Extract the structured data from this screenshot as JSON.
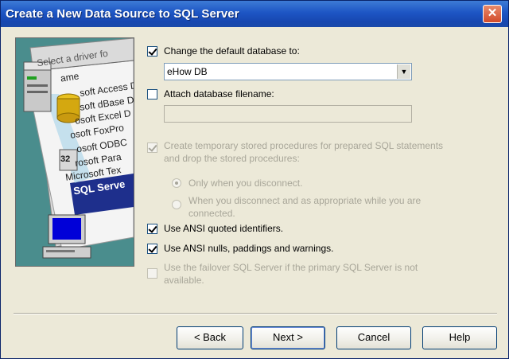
{
  "window": {
    "title": "Create a New Data Source to SQL Server",
    "close_glyph": "✕"
  },
  "wizard_image": {
    "header_text": "Select a driver fo",
    "list_items": [
      "ame",
      "soft Access D",
      "soft dBase D",
      "osoft Excel D",
      "osoft FoxPro",
      "osoft ODBC",
      "rosoft Para",
      "Microsoft Tex"
    ],
    "selected_item": "SQL Serve",
    "badge": "32"
  },
  "options": {
    "change_default_db": {
      "label": "Change the default database to:",
      "checked": true
    },
    "database_select": {
      "value": "eHow DB"
    },
    "attach_filename": {
      "label": "Attach database filename:",
      "checked": false
    },
    "filename_value": "",
    "temp_stored_procs": {
      "line1": "Create temporary stored procedures for prepared SQL statements",
      "line2": "and drop the stored procedures:",
      "checked": true,
      "disabled": true
    },
    "radio_disconnect": {
      "label": "Only when you disconnect.",
      "selected": true
    },
    "radio_appropriate": {
      "line1": "When you disconnect and as appropriate while you are",
      "line2": "connected.",
      "selected": false
    },
    "ansi_quoted": {
      "label": "Use ANSI quoted identifiers.",
      "checked": true
    },
    "ansi_nulls": {
      "label": "Use ANSI nulls, paddings and warnings.",
      "checked": true
    },
    "failover": {
      "line1": "Use the failover SQL Server if the primary SQL Server is not",
      "line2": "available.",
      "checked": false,
      "disabled": true
    }
  },
  "buttons": {
    "back": "< Back",
    "next": "Next >",
    "cancel": "Cancel",
    "help": "Help"
  },
  "colors": {
    "titlebar": "#1d55c4",
    "dialog_bg": "#ece9d8",
    "wizard_bg": "#4a8d8d",
    "disabled_text": "#a8a699"
  }
}
